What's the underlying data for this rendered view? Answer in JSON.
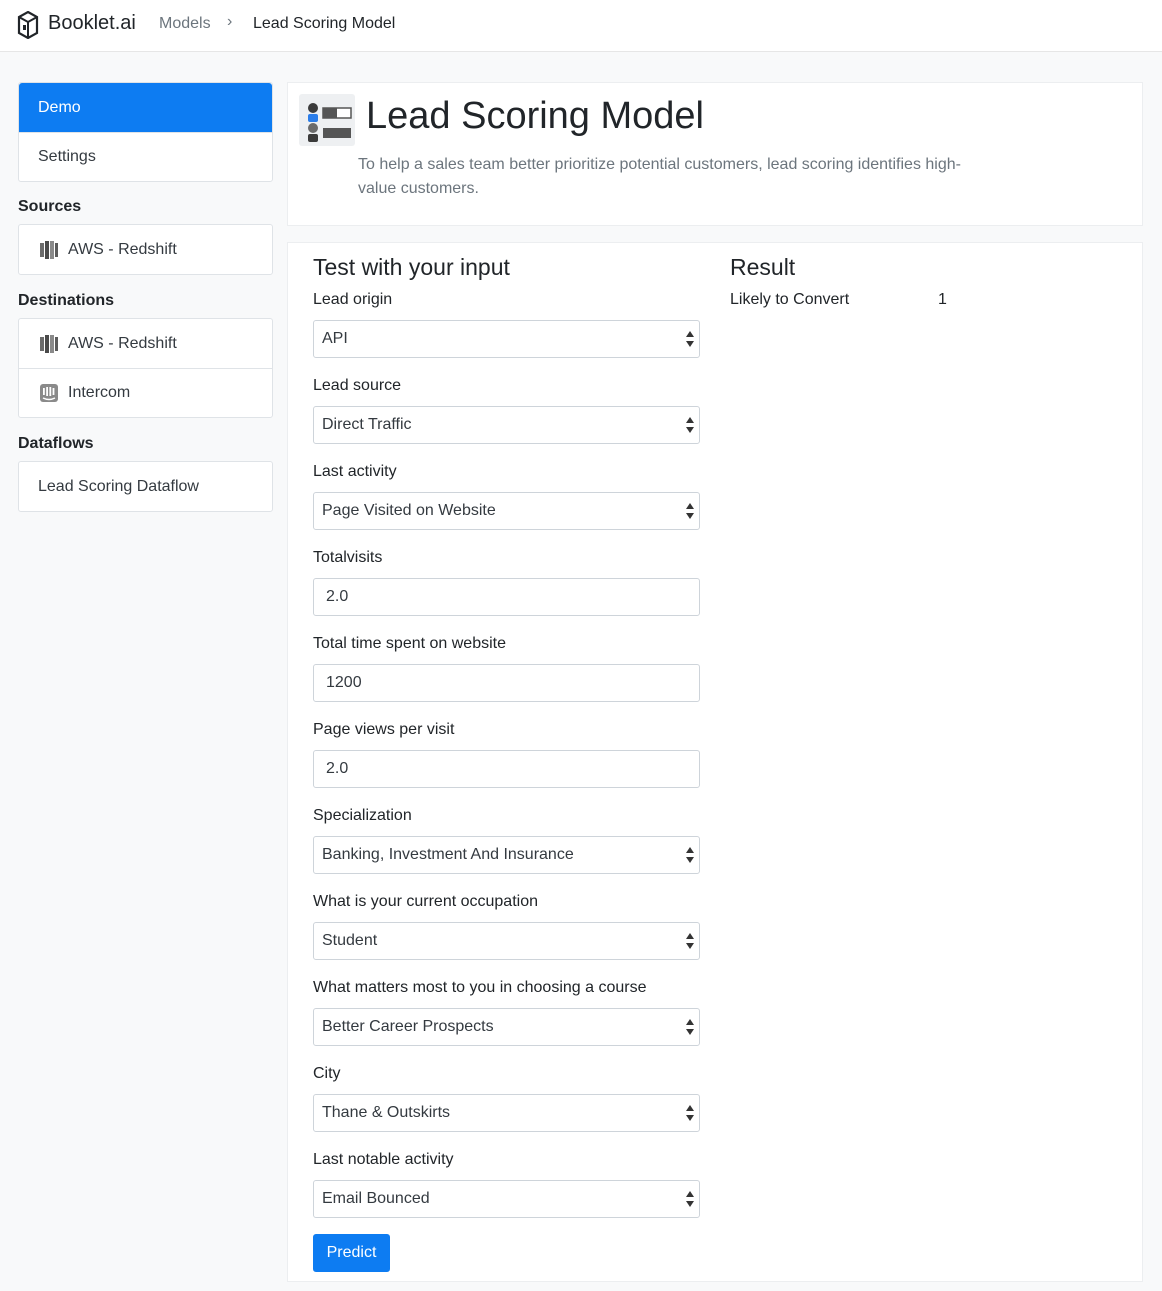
{
  "brand": {
    "name": "Booklet.ai",
    "icon": "box-icon"
  },
  "breadcrumb": {
    "models": "Models",
    "separator": "›",
    "current": "Lead Scoring Model"
  },
  "sidebar": {
    "demo": "Demo",
    "settings": "Settings",
    "sources_heading": "Sources",
    "sources": [
      {
        "label": "AWS - Redshift",
        "icon": "redshift-icon"
      }
    ],
    "destinations_heading": "Destinations",
    "destinations": [
      {
        "label": "AWS - Redshift",
        "icon": "redshift-icon"
      },
      {
        "label": "Intercom",
        "icon": "intercom-icon"
      }
    ],
    "dataflows_heading": "Dataflows",
    "dataflows": [
      {
        "label": "Lead Scoring Dataflow"
      }
    ]
  },
  "model": {
    "title": "Lead Scoring Model",
    "description": "To help a sales team better prioritize potential customers, lead scoring identifies high-value customers."
  },
  "form": {
    "title": "Test with your input",
    "fields": [
      {
        "label": "Lead origin",
        "type": "select",
        "value": "API"
      },
      {
        "label": "Lead source",
        "type": "select",
        "value": "Direct Traffic"
      },
      {
        "label": "Last activity",
        "type": "select",
        "value": "Page Visited on Website"
      },
      {
        "label": "Totalvisits",
        "type": "text",
        "value": "2.0"
      },
      {
        "label": "Total time spent on website",
        "type": "text",
        "value": "1200"
      },
      {
        "label": "Page views per visit",
        "type": "text",
        "value": "2.0"
      },
      {
        "label": "Specialization",
        "type": "select",
        "value": "Banking, Investment And Insurance"
      },
      {
        "label": "What is your current occupation",
        "type": "select",
        "value": "Student"
      },
      {
        "label": "What matters most to you in choosing a course",
        "type": "select",
        "value": "Better Career Prospects"
      },
      {
        "label": "City",
        "type": "select",
        "value": "Thane & Outskirts"
      },
      {
        "label": "Last notable activity",
        "type": "select",
        "value": "Email Bounced"
      }
    ],
    "predict_label": "Predict"
  },
  "result": {
    "title": "Result",
    "label": "Likely to Convert",
    "value": "1"
  },
  "colors": {
    "primary": "#0d7cf2",
    "muted": "#6c757d",
    "border": "#ced4da"
  }
}
